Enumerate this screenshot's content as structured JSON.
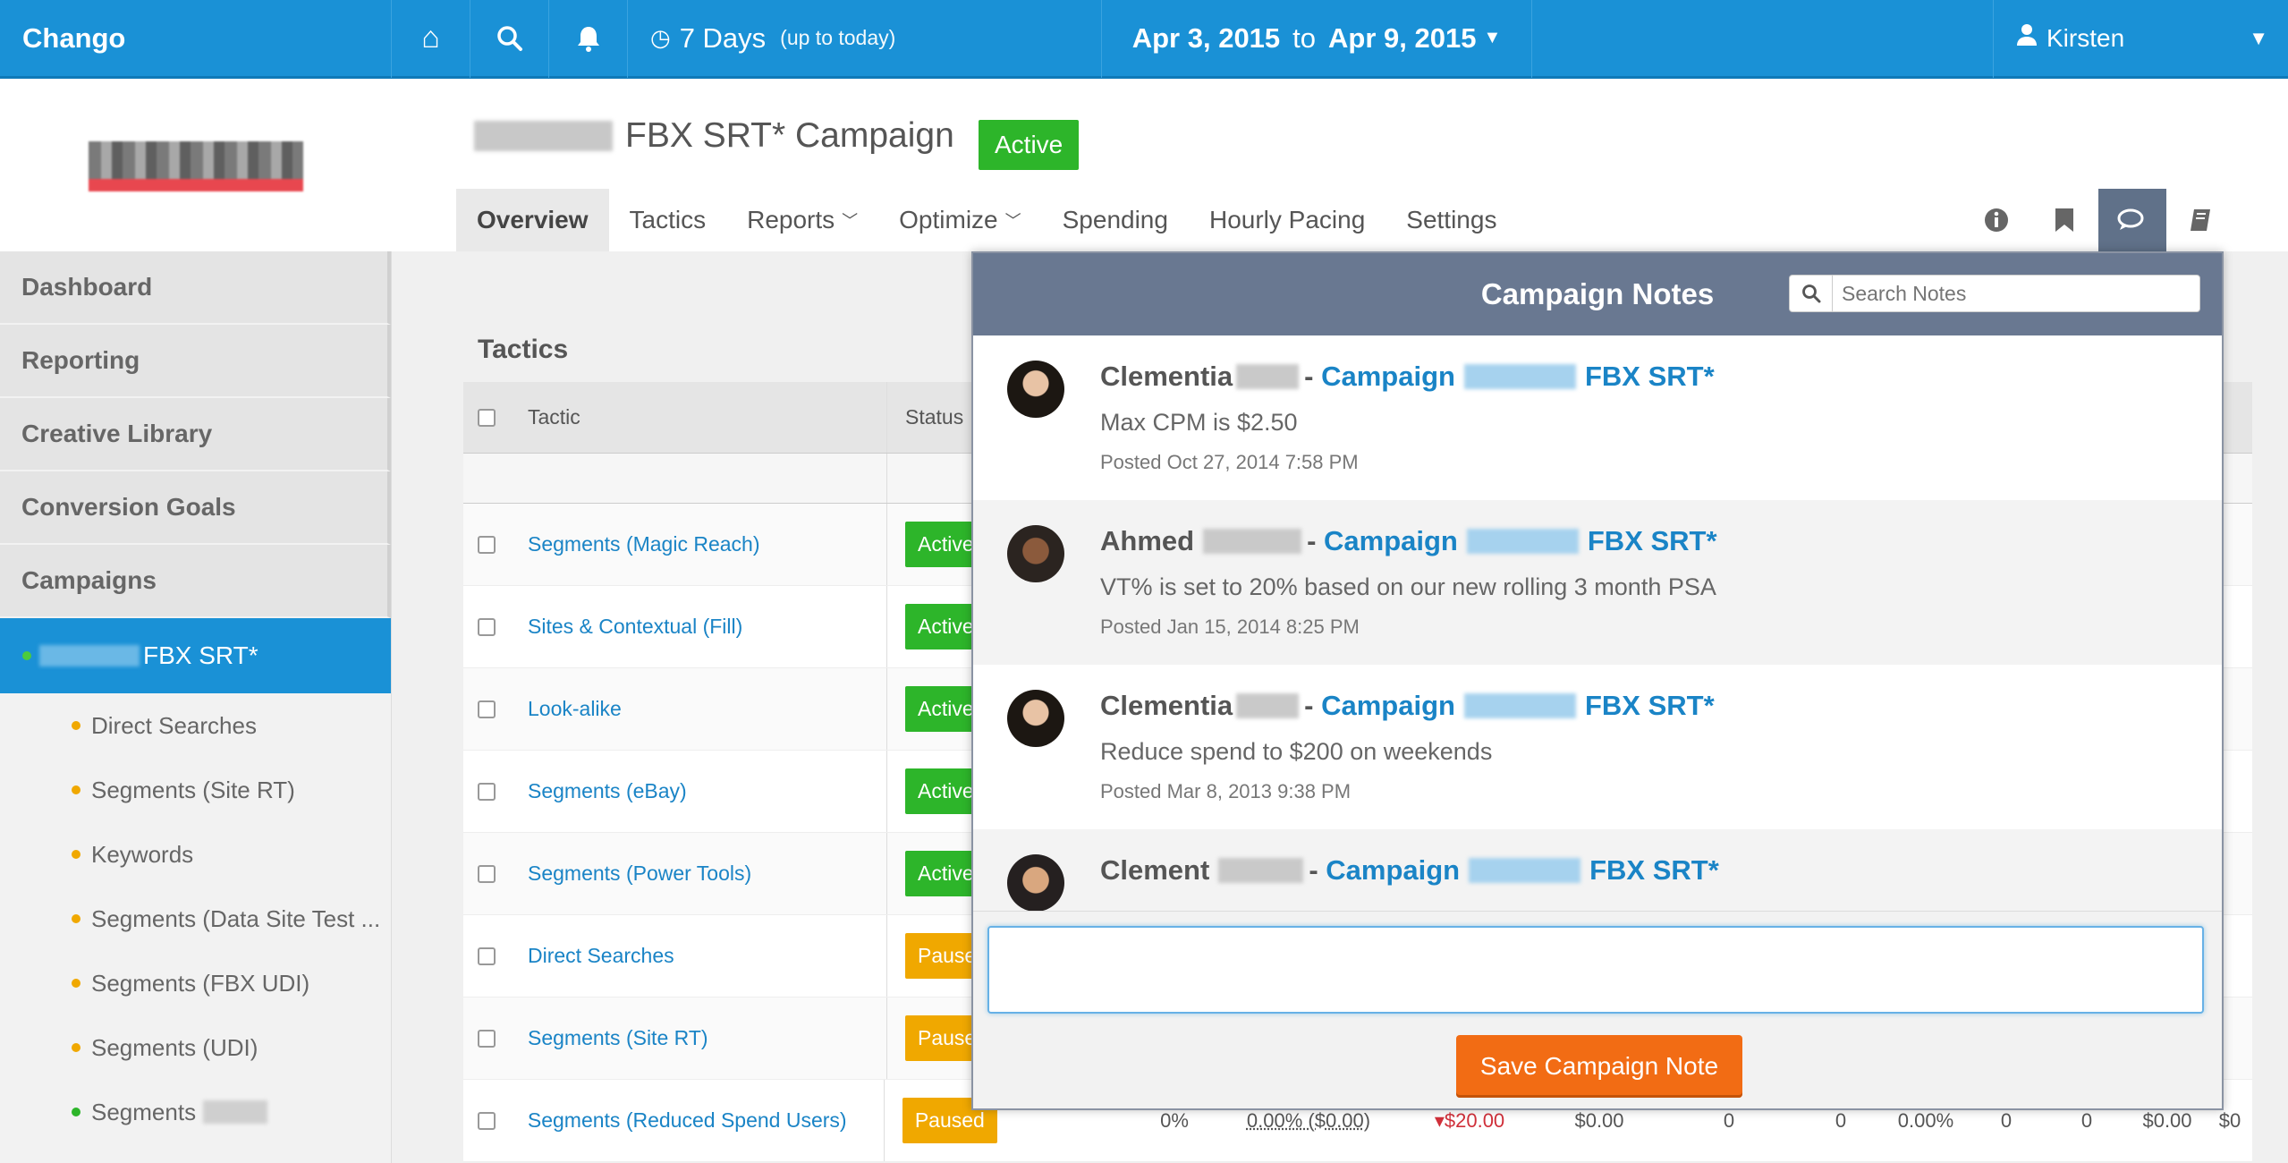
{
  "topbar": {
    "brand": "Chango",
    "range_label": "7 Days",
    "range_note": "(up to today)",
    "date_from": "Apr 3, 2015",
    "date_to_word": "to",
    "date_to": "Apr 9, 2015",
    "user": "Kirsten"
  },
  "campaign": {
    "title": "FBX SRT* Campaign",
    "status": "Active"
  },
  "tabs": [
    {
      "label": "Overview"
    },
    {
      "label": "Tactics"
    },
    {
      "label": "Reports"
    },
    {
      "label": "Optimize"
    },
    {
      "label": "Spending"
    },
    {
      "label": "Hourly Pacing"
    },
    {
      "label": "Settings"
    }
  ],
  "sidebar": {
    "items": [
      "Dashboard",
      "Reporting",
      "Creative Library",
      "Conversion Goals",
      "Campaigns"
    ],
    "campaign": "FBX SRT*",
    "sub": [
      {
        "label": "Direct Searches",
        "color": "#f0a800"
      },
      {
        "label": "Segments (Site RT)",
        "color": "#f0a800"
      },
      {
        "label": "Keywords",
        "color": "#f0a800"
      },
      {
        "label": "Segments (Data Site Test ...",
        "color": "#f0a800"
      },
      {
        "label": "Segments (FBX UDI)",
        "color": "#f0a800"
      },
      {
        "label": "Segments (UDI)",
        "color": "#f0a800"
      },
      {
        "label": "Segments",
        "color": "#2db52a"
      }
    ]
  },
  "tactics": {
    "title": "Tactics",
    "col_tactic": "Tactic",
    "col_status": "Status",
    "rows": [
      {
        "name": "Segments (Magic Reach)",
        "status": "Active"
      },
      {
        "name": "Sites & Contextual (Fill)",
        "status": "Active"
      },
      {
        "name": "Look-alike",
        "status": "Active"
      },
      {
        "name": "Segments (eBay)",
        "status": "Active"
      },
      {
        "name": "Segments (Power Tools)",
        "status": "Active"
      },
      {
        "name": "Direct Searches",
        "status": "Paused"
      },
      {
        "name": "Segments (Site RT)",
        "status": "Paused"
      },
      {
        "name": "Segments (Reduced Spend Users)",
        "status": "Paused"
      }
    ],
    "last_row_stats": [
      "0%",
      "0.00% ($0.00)",
      "▾$20.00",
      "$0.00",
      "0",
      "0",
      "0.00%",
      "0",
      "0",
      "$0.00",
      "$0"
    ]
  },
  "notes": {
    "title": "Campaign Notes",
    "search_placeholder": "Search Notes",
    "items": [
      {
        "author": "Clementia",
        "campaign": "Campaign",
        "campaign_suffix": "FBX SRT*",
        "text": "Max CPM is $2.50",
        "date": "Posted Oct 27, 2014 7:58 PM"
      },
      {
        "author": "Ahmed",
        "campaign": "Campaign",
        "campaign_suffix": "FBX SRT*",
        "text": "VT% is set to 20% based on our new rolling 3 month PSA",
        "date": "Posted Jan 15, 2014 8:25 PM"
      },
      {
        "author": "Clementia",
        "campaign": "Campaign",
        "campaign_suffix": "FBX SRT*",
        "text": "Reduce spend to $200 on weekends",
        "date": "Posted Mar 8, 2013 9:38 PM"
      },
      {
        "author": "Clement",
        "campaign": "Campaign",
        "campaign_suffix": "FBX SRT*",
        "text": "",
        "date": ""
      }
    ],
    "save_label": "Save Campaign Note"
  }
}
